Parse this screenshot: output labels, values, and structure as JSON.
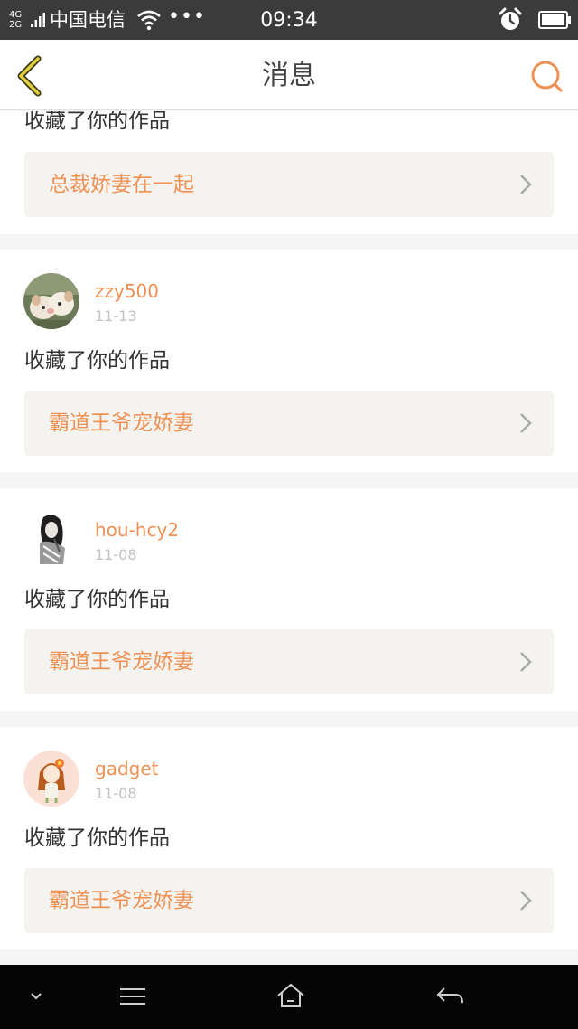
{
  "status_bar": {
    "network": "4G\n2G",
    "carrier": "中国电信",
    "dots": "•••",
    "time": "09:34"
  },
  "header": {
    "title": "消息",
    "back_icon": "chevron-left-icon",
    "search_icon": "search-icon",
    "accent_color": "#ef9155"
  },
  "feed": {
    "partial_first": {
      "action": "收藏了你的作品",
      "work_title": "总裁娇妻在一起"
    },
    "items": [
      {
        "username": "zzy500",
        "date": "11-13",
        "action": "收藏了你的作品",
        "work_title": "霸道王爷宠娇妻"
      },
      {
        "username": "hou-hcy2",
        "date": "11-08",
        "action": "收藏了你的作品",
        "work_title": "霸道王爷宠娇妻"
      },
      {
        "username": "gadget",
        "date": "11-08",
        "action": "收藏了你的作品",
        "work_title": "霸道王爷宠娇妻"
      }
    ]
  },
  "system_nav": {
    "icons": [
      "chevron-down-icon",
      "menu-icon",
      "home-icon",
      "back-arrow-icon"
    ]
  }
}
